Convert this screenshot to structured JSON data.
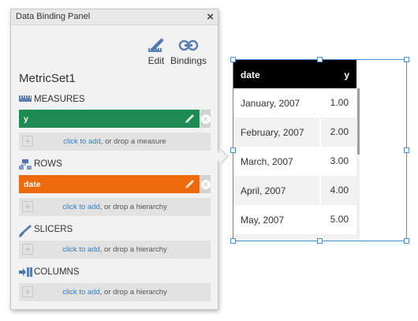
{
  "panel": {
    "title": "Data Binding Panel",
    "close_label": "×",
    "toolbar": {
      "edit_label": "Edit",
      "bindings_label": "Bindings"
    },
    "metric_set": "MetricSet1",
    "sections": {
      "measures": "MEASURES",
      "rows": "ROWS",
      "slicers": "SLICERS",
      "columns": "COLUMNS"
    },
    "measure_field": {
      "label": "y",
      "color": "#1e8c52"
    },
    "row_field": {
      "label": "date",
      "color": "#ef6a0d"
    },
    "dropzones": {
      "link": "click to add",
      "measure_suffix": ", or drop a measure",
      "hierarchy_suffix": ", or drop a hierarchy"
    }
  },
  "table": {
    "headers": {
      "date": "date",
      "y": "y"
    },
    "rows": [
      {
        "date": "January, 2007",
        "y": "1.00"
      },
      {
        "date": "February, 2007",
        "y": "2.00"
      },
      {
        "date": "March, 2007",
        "y": "3.00"
      },
      {
        "date": "April, 2007",
        "y": "4.00"
      },
      {
        "date": "May, 2007",
        "y": "5.00"
      },
      {
        "date": "",
        "y": ""
      }
    ],
    "header_bg": "#000000",
    "stripe_bg": "#f2f2f2"
  },
  "icons": {
    "edit": "pencil-ruler-icon",
    "bindings": "link-chain-icon",
    "measures": "ruler-icon",
    "rows": "hierarchy-icon",
    "slicers": "brush-icon",
    "columns": "columns-arrow-icon"
  }
}
